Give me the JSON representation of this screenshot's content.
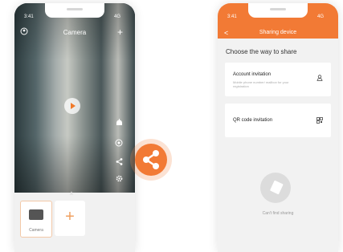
{
  "left_phone": {
    "status_time": "3:41",
    "status_net": "4G",
    "title": "Camera",
    "header_left_icon": "profile-icon",
    "header_right_icon": "plus-icon",
    "side_icons": [
      "alarm-icon",
      "location-icon",
      "share-icon",
      "settings-icon"
    ],
    "devices": [
      {
        "label": "Camera",
        "icon": "camera-icon"
      },
      {
        "label": "+",
        "icon": "add-icon"
      }
    ]
  },
  "share_fab": {
    "icon": "share-icon",
    "color": "#F27A35"
  },
  "right_phone": {
    "status_time": "3:41",
    "status_net": "4G",
    "title": "Sharing device",
    "back_glyph": "<",
    "heading": "Choose the way to share",
    "options": [
      {
        "title": "Account invitation",
        "subtitle": "Mobile phone number/ mailbox for your registration",
        "icon": "user-icon"
      },
      {
        "title": "QR code invitation",
        "subtitle": "",
        "icon": "qr-code-icon"
      }
    ],
    "empty_text": "Can't find sharing"
  },
  "colors": {
    "accent": "#F27A35"
  }
}
